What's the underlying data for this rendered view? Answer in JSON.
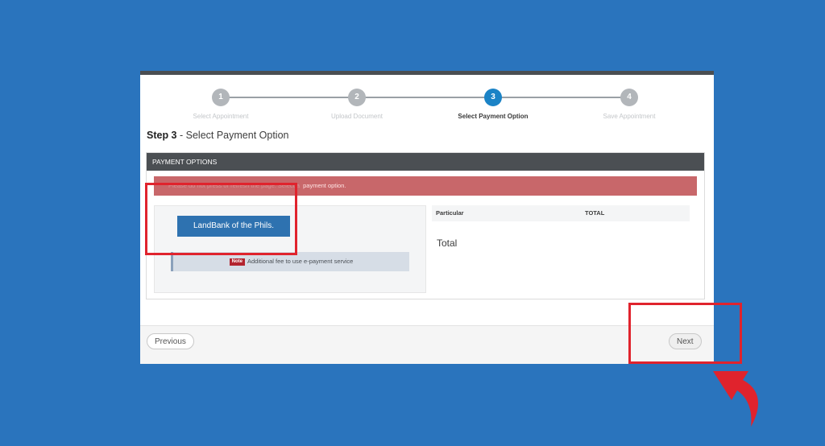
{
  "stepper": {
    "steps": [
      {
        "number": "1",
        "label": "Select Appointment"
      },
      {
        "number": "2",
        "label": "Upload Document"
      },
      {
        "number": "3",
        "label": "Select Payment Option"
      },
      {
        "number": "4",
        "label": "Save Appointment"
      }
    ],
    "active_index": 2
  },
  "step_title": {
    "prefix": "Step 3",
    "text": " - Select Payment Option"
  },
  "panel": {
    "heading": "PAYMENT OPTIONS",
    "alert_faded": "Please do not press or refresh the page. Select a",
    "alert_message": "payment option."
  },
  "payment": {
    "bank_button": "LandBank of the Phils.",
    "note_badge": "Note",
    "note_text": "Additional fee to use e-payment service"
  },
  "summary": {
    "col_particular": "Particular",
    "col_total": "TOTAL",
    "total_label": "Total"
  },
  "footer": {
    "previous": "Previous",
    "next": "Next"
  },
  "colors": {
    "page_background": "#2a74bd",
    "active_step": "#1b83c6",
    "alert": "#c8676a",
    "bank_button": "#2e72b0",
    "highlight": "#e0232d"
  }
}
